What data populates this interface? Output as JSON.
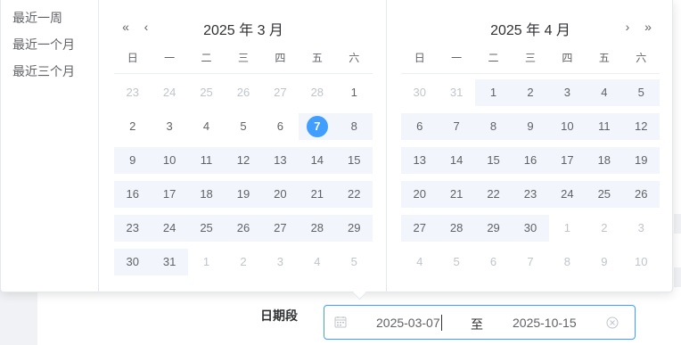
{
  "shortcuts": [
    "最近一周",
    "最近一个月",
    "最近三个月"
  ],
  "nav": {
    "prev_year": "«",
    "prev_month": "‹",
    "next_month": "›",
    "next_year": "»"
  },
  "left_calendar": {
    "title": "2025 年 3 月",
    "weekdays": [
      "日",
      "一",
      "二",
      "三",
      "四",
      "五",
      "六"
    ],
    "rows": [
      [
        "23",
        "24",
        "25",
        "26",
        "27",
        "28",
        "1"
      ],
      [
        "2",
        "3",
        "4",
        "5",
        "6",
        "7",
        "8"
      ],
      [
        "9",
        "10",
        "11",
        "12",
        "13",
        "14",
        "15"
      ],
      [
        "16",
        "17",
        "18",
        "19",
        "20",
        "21",
        "22"
      ],
      [
        "23",
        "24",
        "25",
        "26",
        "27",
        "28",
        "29"
      ],
      [
        "30",
        "31",
        "1",
        "2",
        "3",
        "4",
        "5"
      ]
    ]
  },
  "right_calendar": {
    "title": "2025 年 4 月",
    "weekdays": [
      "日",
      "一",
      "二",
      "三",
      "四",
      "五",
      "六"
    ],
    "rows": [
      [
        "30",
        "31",
        "1",
        "2",
        "3",
        "4",
        "5"
      ],
      [
        "6",
        "7",
        "8",
        "9",
        "10",
        "11",
        "12"
      ],
      [
        "13",
        "14",
        "15",
        "16",
        "17",
        "18",
        "19"
      ],
      [
        "20",
        "21",
        "22",
        "23",
        "24",
        "25",
        "26"
      ],
      [
        "27",
        "28",
        "29",
        "30",
        "1",
        "2",
        "3"
      ],
      [
        "4",
        "5",
        "6",
        "7",
        "8",
        "9",
        "10"
      ]
    ]
  },
  "form": {
    "label": "日期段",
    "start_value": "2025-03-07",
    "separator": "至",
    "end_value": "2025-10-15"
  },
  "colors": {
    "accent": "#409eff",
    "range_bg": "#f2f6fc",
    "muted": "#c0c4cc"
  }
}
